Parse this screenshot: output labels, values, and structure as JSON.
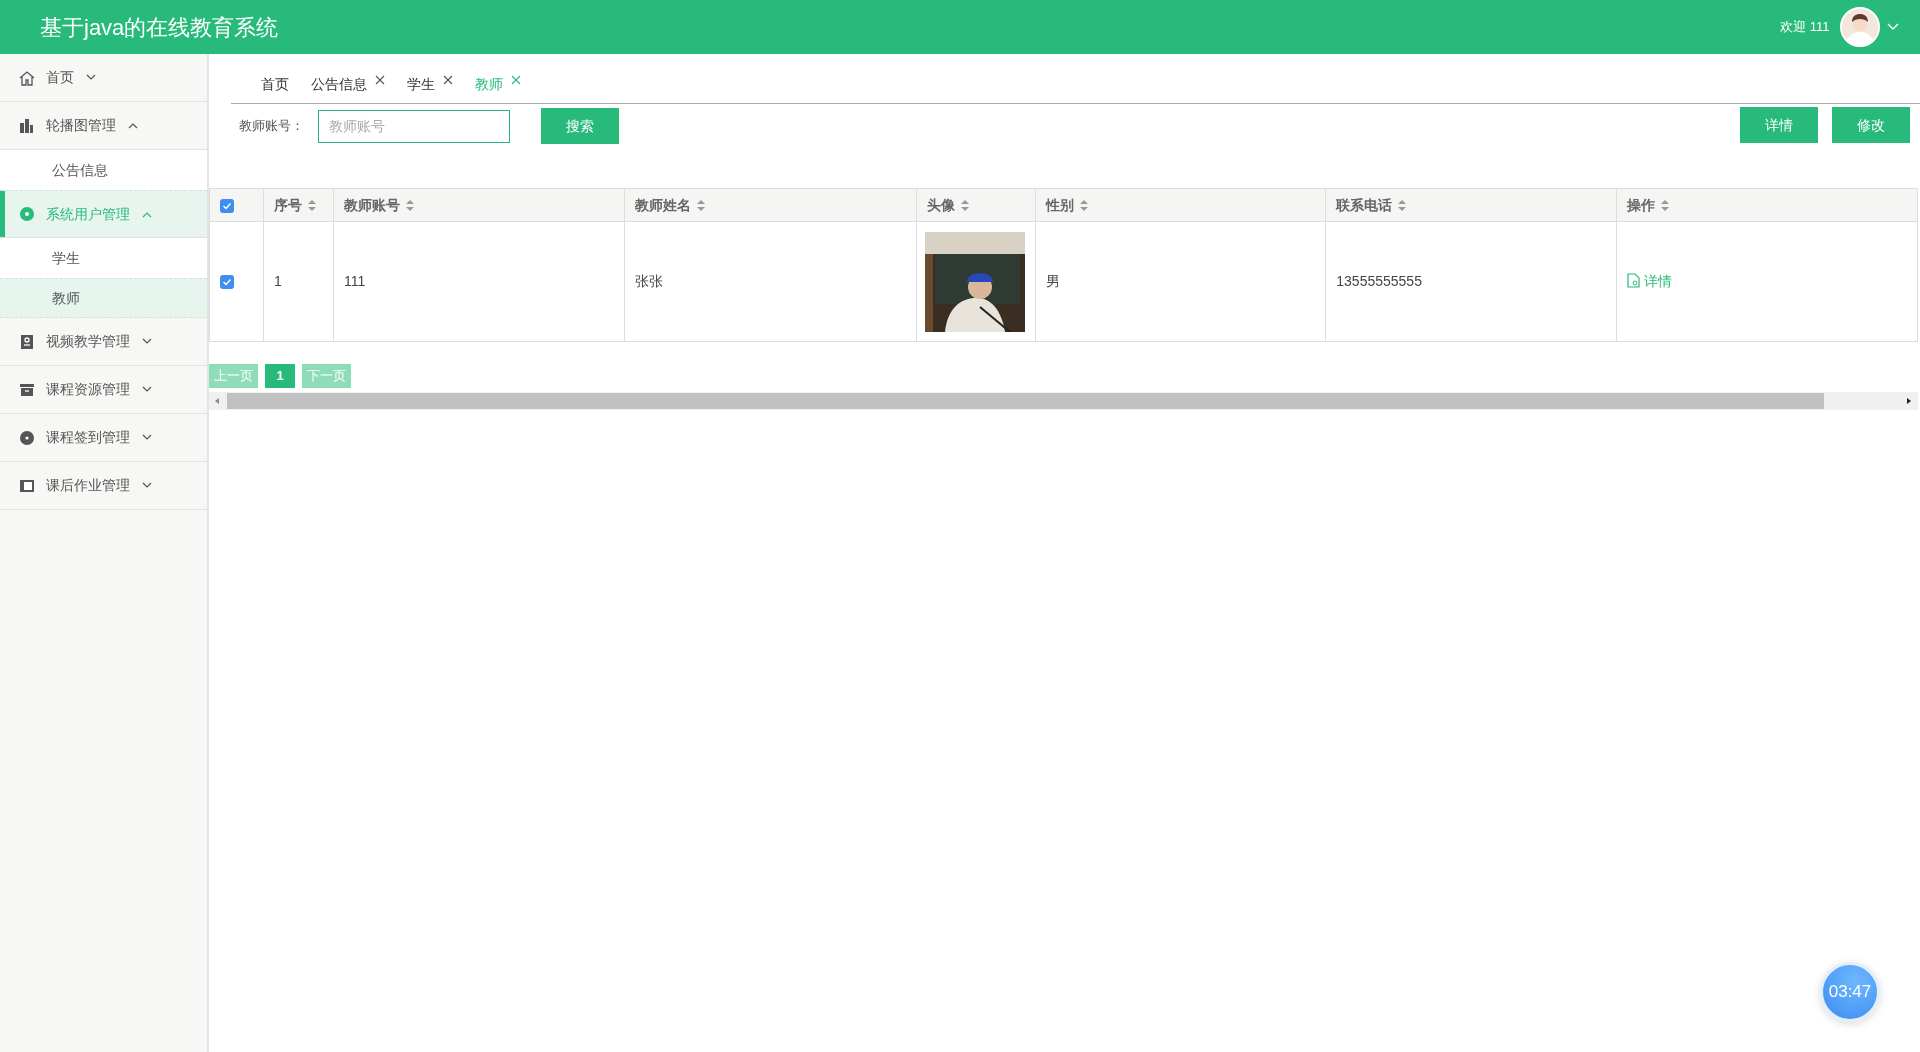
{
  "header": {
    "title": "基于java的在线教育系统",
    "welcome": "欢迎 111"
  },
  "sidebar": {
    "items": [
      {
        "label": "首页",
        "expanded": false,
        "selected": false
      },
      {
        "label": "轮播图管理",
        "expanded": true,
        "selected": false,
        "children": [
          {
            "label": "公告信息",
            "selected": false
          }
        ]
      },
      {
        "label": "系统用户管理",
        "expanded": true,
        "selected": true,
        "children": [
          {
            "label": "学生",
            "selected": false
          },
          {
            "label": "教师",
            "selected": true
          }
        ]
      },
      {
        "label": "视频教学管理",
        "expanded": false,
        "selected": false
      },
      {
        "label": "课程资源管理",
        "expanded": false,
        "selected": false
      },
      {
        "label": "课程签到管理",
        "expanded": false,
        "selected": false
      },
      {
        "label": "课后作业管理",
        "expanded": false,
        "selected": false
      }
    ]
  },
  "tabs": [
    {
      "label": "首页",
      "closable": false,
      "selected": false
    },
    {
      "label": "公告信息",
      "closable": true,
      "selected": false
    },
    {
      "label": "学生",
      "closable": true,
      "selected": false
    },
    {
      "label": "教师",
      "closable": true,
      "selected": true
    }
  ],
  "search": {
    "label": "教师账号：",
    "placeholder": "教师账号",
    "button": "搜索"
  },
  "actions": [
    "详情",
    "修改"
  ],
  "table": {
    "select_all": true,
    "columns": [
      {
        "label": "序号",
        "sortable": true
      },
      {
        "label": "教师账号",
        "sortable": true
      },
      {
        "label": "教师姓名",
        "sortable": true
      },
      {
        "label": "头像",
        "sortable": true
      },
      {
        "label": "性别",
        "sortable": true
      },
      {
        "label": "联系电话",
        "sortable": true
      },
      {
        "label": "操作",
        "sortable": true
      }
    ],
    "rows": [
      {
        "checked": true,
        "cells": [
          {
            "kind": "text",
            "text": "1"
          },
          {
            "kind": "text",
            "text": "111"
          },
          {
            "kind": "text",
            "text": "张张"
          },
          {
            "kind": "picture"
          },
          {
            "kind": "text",
            "text": "男"
          },
          {
            "kind": "text",
            "text": "13555555555"
          },
          {
            "kind": "link",
            "text": "详情"
          }
        ]
      }
    ]
  },
  "pagination": {
    "prev": "上一页",
    "pages": [
      {
        "label": "1",
        "selected": true
      }
    ],
    "next": "下一页"
  },
  "timer": "03:47"
}
